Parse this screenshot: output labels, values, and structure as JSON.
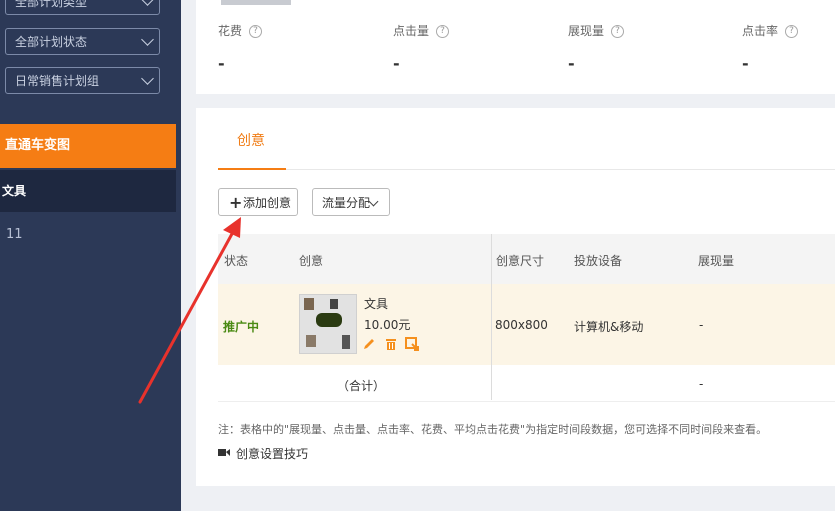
{
  "sidebar": {
    "filters": [
      "全部计划类型",
      "全部计划状态",
      "日常销售计划组"
    ],
    "active_item": "直通车变图",
    "sub_item": "文具",
    "number": "11"
  },
  "stats": [
    {
      "label": "花费",
      "value": "-"
    },
    {
      "label": "点击量",
      "value": "-"
    },
    {
      "label": "展现量",
      "value": "-"
    },
    {
      "label": "点击率",
      "value": "-"
    }
  ],
  "tabs": {
    "active": "创意"
  },
  "toolbar": {
    "add_label": "添加创意",
    "flow_label": "流量分配"
  },
  "table": {
    "headers": [
      "状态",
      "创意",
      "创意尺寸",
      "投放设备",
      "展现量"
    ],
    "row": {
      "status": "推广中",
      "title": "文具",
      "price": "10.00元",
      "size": "800x800",
      "device": "计算机&移动",
      "impressions": "-"
    },
    "total": {
      "label": "（合计）",
      "impressions": "-"
    }
  },
  "note": "注：表格中的\"展现量、点击量、点击率、花费、平均点击花费\"为指定时间段数据，您可选择不同时间段来查看。",
  "tip": "创意设置技巧",
  "colors": {
    "accent": "#f57d14",
    "sidebar": "#2c3957",
    "arrow": "#e8322c",
    "status": "#4a8a14"
  }
}
